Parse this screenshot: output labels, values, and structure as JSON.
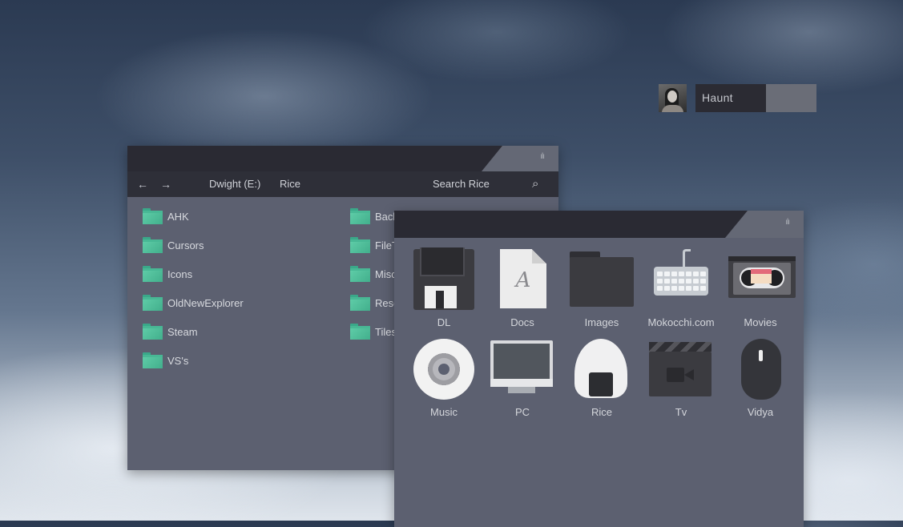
{
  "user": {
    "name": "Haunt"
  },
  "explorer": {
    "window_control": "ılı",
    "nav": {
      "back": "←",
      "forward": "→",
      "drive": "Dwight (E:)",
      "folder": "Rice",
      "search_placeholder": "Search Rice",
      "search_icon": "⌕"
    },
    "folders_left": [
      "AHK",
      "Cursors",
      "Icons",
      "OldNewExplorer",
      "Steam",
      "VS's"
    ],
    "folders_right": [
      "Back",
      "FileT",
      "Misc",
      "Reso",
      "Tiles"
    ]
  },
  "places": {
    "window_control": "ılı",
    "items": [
      {
        "label": "DL",
        "icon": "floppy-disk-icon"
      },
      {
        "label": "Docs",
        "icon": "document-icon",
        "glyph": "A"
      },
      {
        "label": "Images",
        "icon": "folder-icon"
      },
      {
        "label": "Mokocchi.com",
        "icon": "keyboard-icon"
      },
      {
        "label": "Movies",
        "icon": "vhs-tape-icon"
      },
      {
        "label": "Music",
        "icon": "cd-icon"
      },
      {
        "label": "PC",
        "icon": "monitor-icon"
      },
      {
        "label": "Rice",
        "icon": "onigiri-icon"
      },
      {
        "label": "Tv",
        "icon": "clapperboard-icon"
      },
      {
        "label": "Vidya",
        "icon": "mouse-icon"
      }
    ]
  },
  "colors": {
    "folder_green": "#48b895",
    "titlebar_dark": "#2a2a33",
    "window_bg": "#5c6070"
  }
}
